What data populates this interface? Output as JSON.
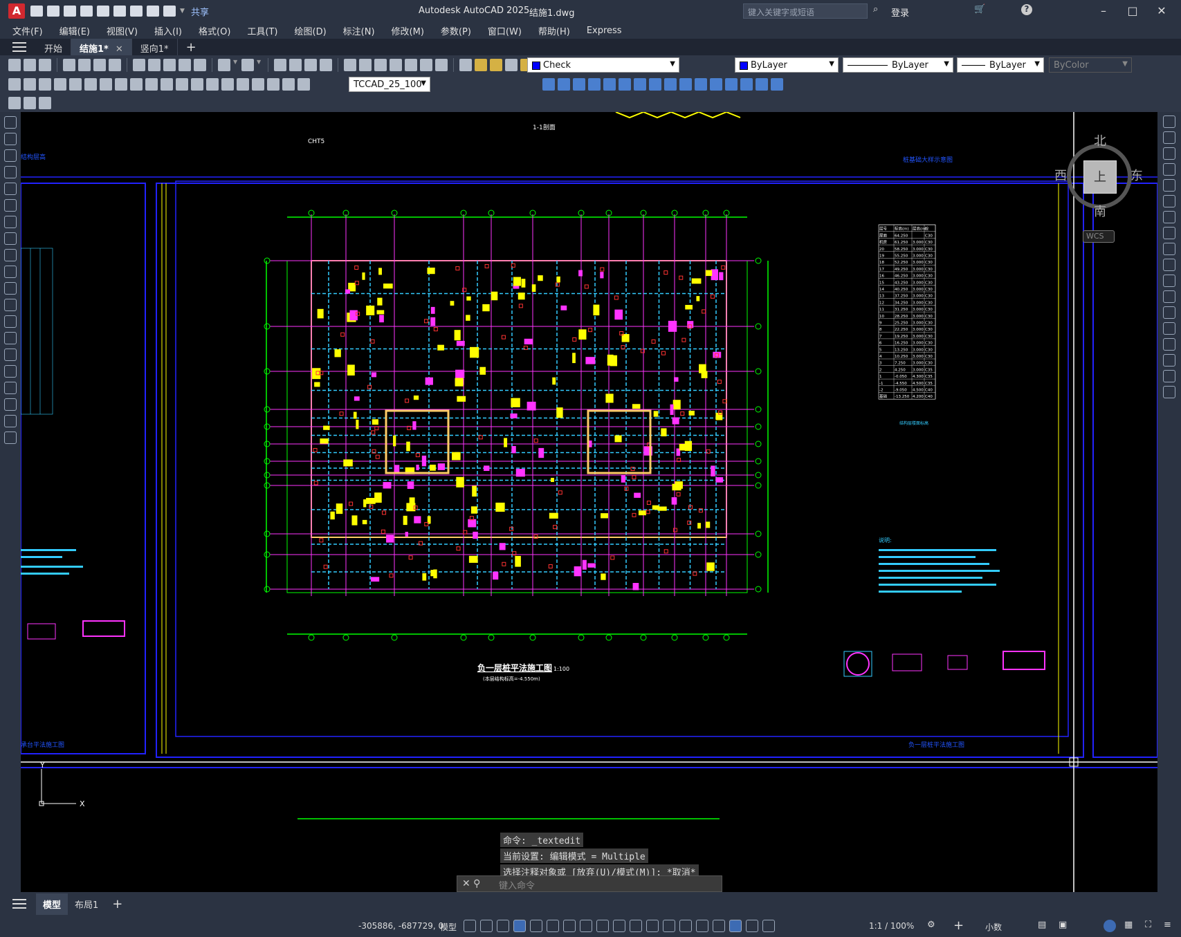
{
  "app": {
    "logo": "A",
    "title": "Autodesk AutoCAD 2025",
    "file": "结施1.dwg",
    "share": "共享",
    "search_placeholder": "键入关键字或短语",
    "login": "登录",
    "help": "?"
  },
  "menu": [
    "文件(F)",
    "编辑(E)",
    "视图(V)",
    "插入(I)",
    "格式(O)",
    "工具(T)",
    "绘图(D)",
    "标注(N)",
    "修改(M)",
    "参数(P)",
    "窗口(W)",
    "帮助(H)",
    "Express"
  ],
  "tabs": [
    {
      "label": "开始",
      "active": false
    },
    {
      "label": "结施1*",
      "active": true,
      "close": "✕"
    },
    {
      "label": "竖向1*",
      "active": false
    }
  ],
  "tab_add": "+",
  "toolbar": {
    "layer": "Check",
    "color": "ByLayer",
    "linetype": "ByLayer",
    "lineweight": "ByLayer",
    "plotstyle": "ByColor",
    "textstyle": "TCCAD_25_100"
  },
  "viewcube": {
    "north": "北",
    "south": "南",
    "east": "东",
    "west": "西",
    "face": "上",
    "wcs": "WCS"
  },
  "drawing": {
    "main_title": "负一层桩平法施工图",
    "main_subtitle": "(本层结构标高=-4.550m)",
    "scale_text": "1:100",
    "section_label": "1-1剖面",
    "notes_title": "说明:",
    "legend_title": "结构层楼面标高",
    "legend_sub": "结构层高",
    "bottom_right_title": "负一层桩平法施工图",
    "left_bottom_title": "承台平法施工图",
    "top_label": "CHT5",
    "top_right_label": "桩基础大样示意图",
    "table_header": [
      "层号",
      "标高(m)",
      "层高(m)",
      "砼"
    ],
    "table_rows": [
      [
        "屋面",
        "64.250",
        "",
        "C30"
      ],
      [
        "机房",
        "61.250",
        "3.000",
        "C30"
      ],
      [
        "20",
        "58.250",
        "3.000",
        "C30"
      ],
      [
        "19",
        "55.250",
        "3.000",
        "C30"
      ],
      [
        "18",
        "52.250",
        "3.000",
        "C30"
      ],
      [
        "17",
        "49.250",
        "3.000",
        "C30"
      ],
      [
        "16",
        "46.250",
        "3.000",
        "C30"
      ],
      [
        "15",
        "43.250",
        "3.000",
        "C30"
      ],
      [
        "14",
        "40.250",
        "3.000",
        "C30"
      ],
      [
        "13",
        "37.250",
        "3.000",
        "C30"
      ],
      [
        "12",
        "34.250",
        "3.000",
        "C30"
      ],
      [
        "11",
        "31.250",
        "3.000",
        "C30"
      ],
      [
        "10",
        "28.250",
        "3.000",
        "C30"
      ],
      [
        "9",
        "25.250",
        "3.000",
        "C30"
      ],
      [
        "8",
        "22.250",
        "3.000",
        "C30"
      ],
      [
        "7",
        "19.250",
        "3.000",
        "C30"
      ],
      [
        "6",
        "16.250",
        "3.000",
        "C30"
      ],
      [
        "5",
        "13.250",
        "3.000",
        "C30"
      ],
      [
        "4",
        "10.250",
        "3.000",
        "C30"
      ],
      [
        "3",
        "7.250",
        "3.000",
        "C30"
      ],
      [
        "2",
        "4.250",
        "3.000",
        "C35"
      ],
      [
        "1",
        "-0.050",
        "4.300",
        "C35"
      ],
      [
        "-1",
        "-4.550",
        "4.500",
        "C35"
      ],
      [
        "-2",
        "-9.050",
        "4.500",
        "C40"
      ],
      [
        "基础",
        "-13.250",
        "4.200",
        "C40"
      ]
    ]
  },
  "command": {
    "line1": "命令: _textedit",
    "line2": "当前设置: 编辑模式 = Multiple",
    "line3": "选择注释对象或 [放弃(U)/模式(M)]: *取消*",
    "placeholder": "键入命令"
  },
  "layouts": [
    {
      "label": "模型",
      "active": true
    },
    {
      "label": "布局1",
      "active": false
    }
  ],
  "layout_add": "+",
  "status": {
    "coords": "-305886, -687729, 0",
    "model": "模型",
    "scale": "1:1 / 100%",
    "units": "小数"
  }
}
